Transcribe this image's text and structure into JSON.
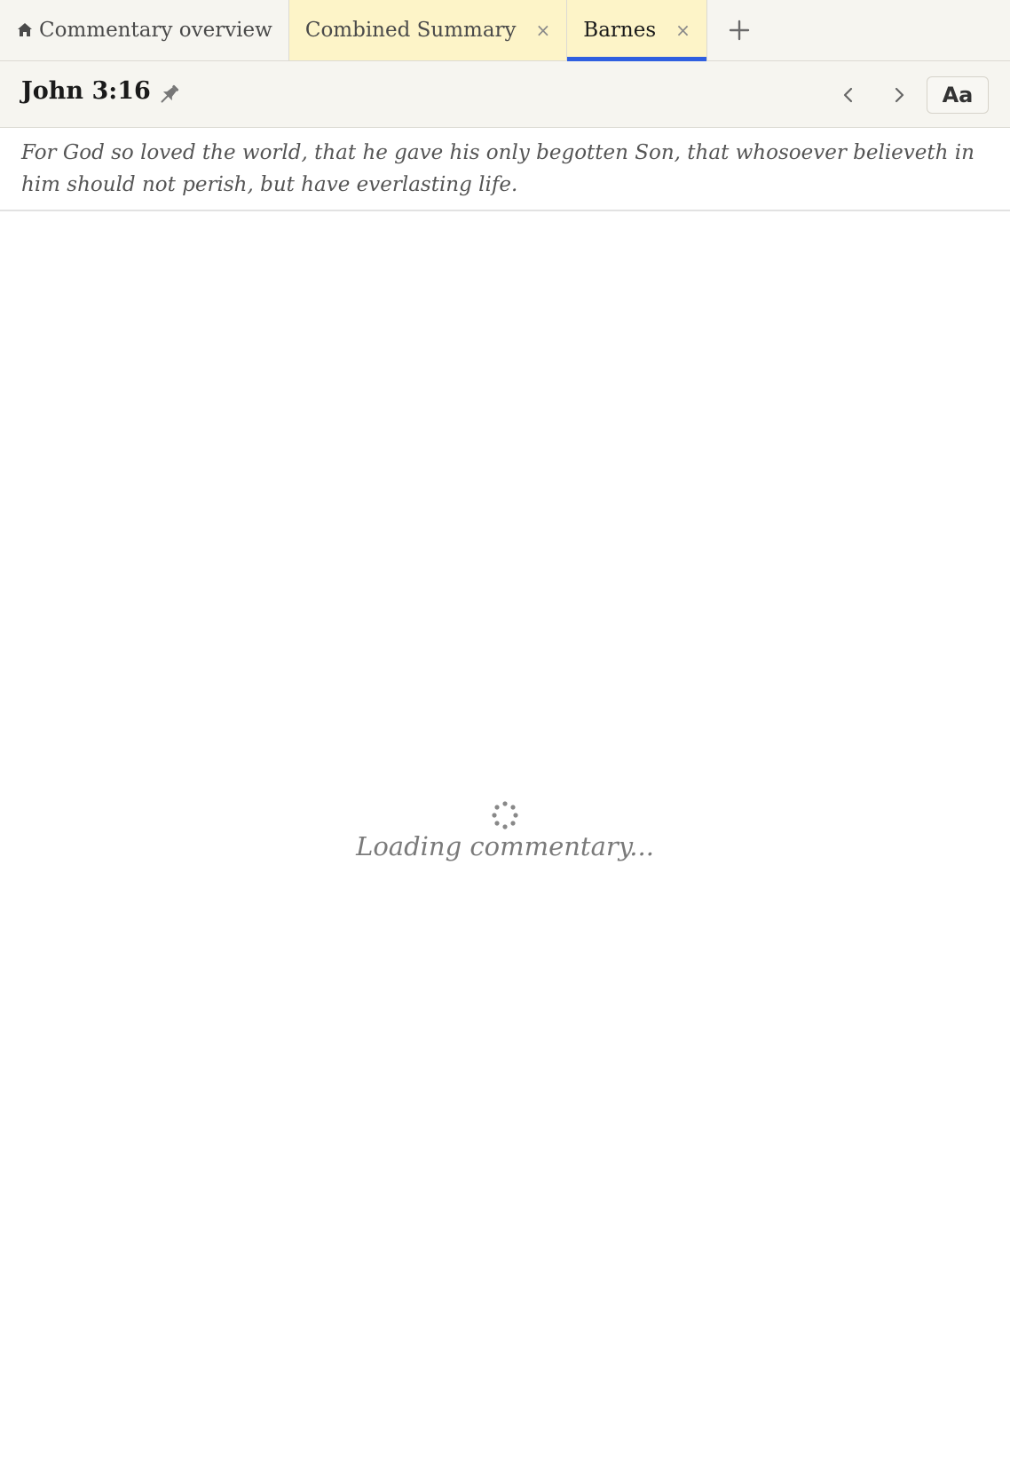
{
  "tabs": [
    {
      "label": "Commentary overview",
      "icon": "home-icon",
      "closable": false
    },
    {
      "label": "Combined Summary",
      "closable": true,
      "close_label": "×"
    },
    {
      "label": "Barnes",
      "closable": true,
      "close_label": "×",
      "active": true
    }
  ],
  "add_tab_icon": "plus-icon",
  "header": {
    "reference": "John 3:16",
    "pin_icon": "pin-icon",
    "prev_icon": "chevron-left-icon",
    "next_icon": "chevron-right-icon",
    "font_button_label": "Aa"
  },
  "verse_text": "For God so loved the world, that he gave his only begotten Son, that whosoever believeth in him should not perish, but have everlasting life.",
  "loading": {
    "text": "Loading commentary...",
    "icon": "spinner-icon"
  },
  "colors": {
    "accent": "#2f5fe0",
    "tab_highlight": "#fdf4c8",
    "chrome_bg": "#f6f5f0"
  }
}
